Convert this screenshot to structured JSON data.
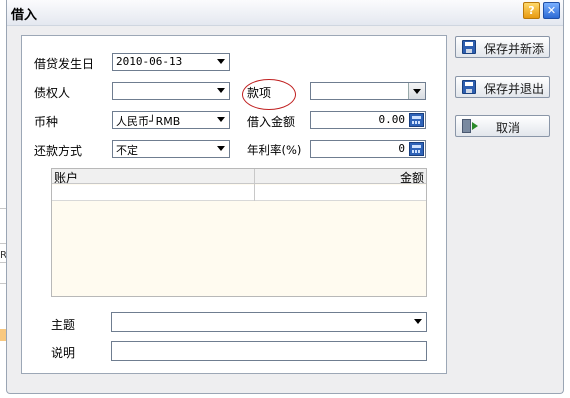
{
  "window": {
    "title": "借入",
    "help_glyph": "?",
    "close_glyph": "✕"
  },
  "form": {
    "date": {
      "label": "借贷发生日",
      "value": "2010-06-13"
    },
    "creditor": {
      "label": "债权人",
      "value": ""
    },
    "item": {
      "label": "款项",
      "value": ""
    },
    "currency": {
      "label": "币种",
      "value": "人民币┘RMB"
    },
    "amount": {
      "label": "借入金额",
      "value": "0.00"
    },
    "repayment": {
      "label": "还款方式",
      "value": "不定"
    },
    "rate": {
      "label": "年利率(%)",
      "value": "0"
    }
  },
  "grid": {
    "columns": [
      "账户",
      "金额"
    ],
    "rows": []
  },
  "subject": {
    "label": "主题",
    "value": ""
  },
  "note": {
    "label": "说明",
    "value": ""
  },
  "actions": {
    "save_new": "保存并新添",
    "save_exit": "保存并退出",
    "cancel": "取消"
  },
  "background_app": {
    "row_label": "R"
  },
  "colors": {
    "annotation_circle": "#c02020",
    "grid_fill": "#fffbf0",
    "calc_icon": "#2f63b8"
  }
}
